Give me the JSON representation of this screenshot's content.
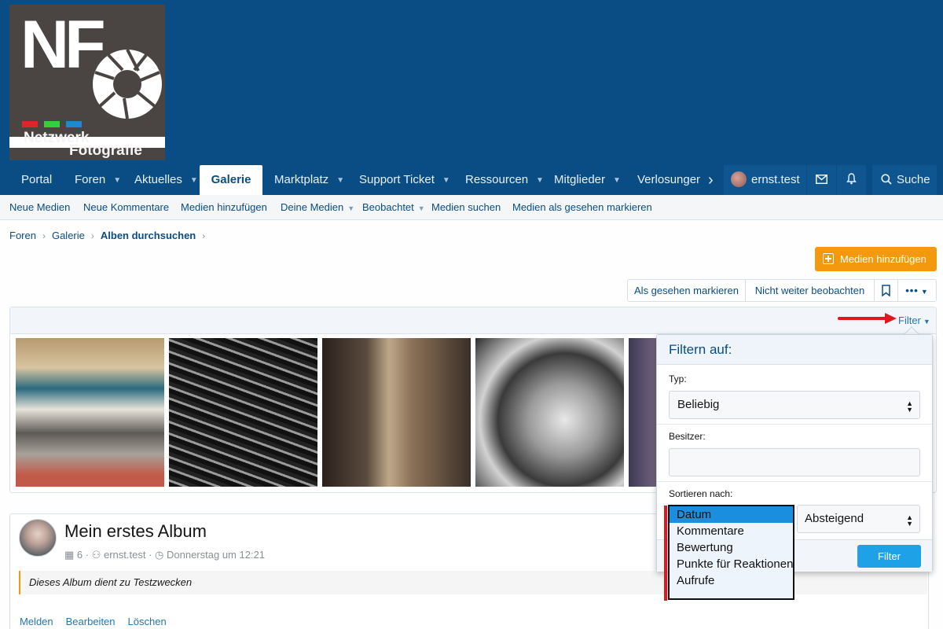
{
  "logo": {
    "big": "NF",
    "line1": "Netzwerk",
    "line2": "Fotografie",
    "bar_colors": [
      "#e3232b",
      "#35d13a",
      "#1c88d0"
    ]
  },
  "nav": {
    "items": [
      "Portal",
      "Foren",
      "Aktuelles",
      "Galerie",
      "Marktplatz",
      "Support Ticket",
      "Ressourcen",
      "Mitglieder",
      "Verlosungen"
    ],
    "active": "Galerie",
    "user": "ernst.test",
    "search": "Suche"
  },
  "subnav": [
    "Neue Medien",
    "Neue Kommentare",
    "Medien hinzufügen",
    "Deine Medien",
    "Beobachtet",
    "Medien suchen",
    "Medien als gesehen markieren"
  ],
  "breadcrumb": [
    "Foren",
    "Galerie",
    "Alben durchsuchen"
  ],
  "add_button": "Medien hinzufügen",
  "actions": {
    "mark_seen": "Als gesehen markieren",
    "unwatch": "Nicht weiter beobachten"
  },
  "filter_link": "Filter",
  "filter_popup": {
    "title": "Filtern auf:",
    "type_label": "Typ:",
    "type_value": "Beliebig",
    "owner_label": "Besitzer:",
    "owner_value": "",
    "sort_label": "Sortieren nach:",
    "sort_options": [
      "Datum",
      "Kommentare",
      "Bewertung",
      "Punkte für Reaktionen",
      "Aufrufe"
    ],
    "sort_selected": "Datum",
    "order_value": "Absteigend",
    "submit": "Filter"
  },
  "album": {
    "title": "Mein erstes Album",
    "count": "6",
    "owner": "ernst.test",
    "date": "Donnerstag um 12:21",
    "description": "Dieses Album dient zu Testzwecken",
    "links": [
      "Melden",
      "Bearbeiten",
      "Löschen"
    ]
  },
  "colors": {
    "header": "#0a4d84",
    "accent": "#f4990d",
    "link": "#2577b1",
    "button": "#1fa1e8",
    "annotation": "#e0171f"
  }
}
